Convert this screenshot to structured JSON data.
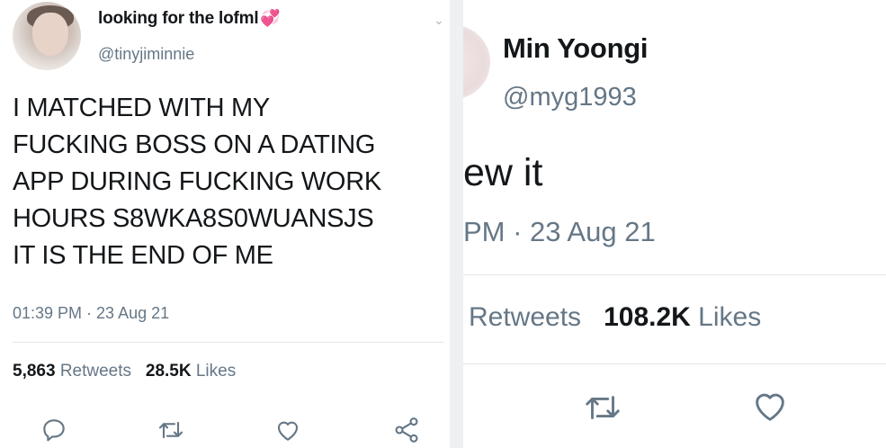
{
  "left_tweet": {
    "display_name": "looking for the lofml",
    "name_emoji": "💞",
    "handle": "@tinyjiminnie",
    "text_lines": [
      "I MATCHED WITH MY",
      "FUCKING BOSS ON A DATING",
      "APP DURING FUCKING WORK",
      "HOURS S8WKA8S0WUANSJS",
      "IT IS THE END OF ME"
    ],
    "timestamp": "01:39 PM · 23 Aug 21",
    "retweets_count": "5,863",
    "retweets_label": "Retweets",
    "likes_count": "28.5K",
    "likes_label": "Likes",
    "icons": [
      "reply-icon",
      "retweet-icon",
      "like-icon",
      "share-icon"
    ]
  },
  "right_tweet": {
    "display_name": "Min Yoongi",
    "handle": "@myg1993",
    "text": "ew it",
    "timestamp": "PM · 23 Aug 21",
    "retweets_label": "Retweets",
    "likes_count": "108.2K",
    "likes_label": "Likes",
    "icons": [
      "retweet-icon",
      "like-icon"
    ]
  },
  "colors": {
    "text": "#14171a",
    "secondary": "#657786",
    "divider": "#e1e8ed",
    "emoji_heart": "#e0245e"
  }
}
